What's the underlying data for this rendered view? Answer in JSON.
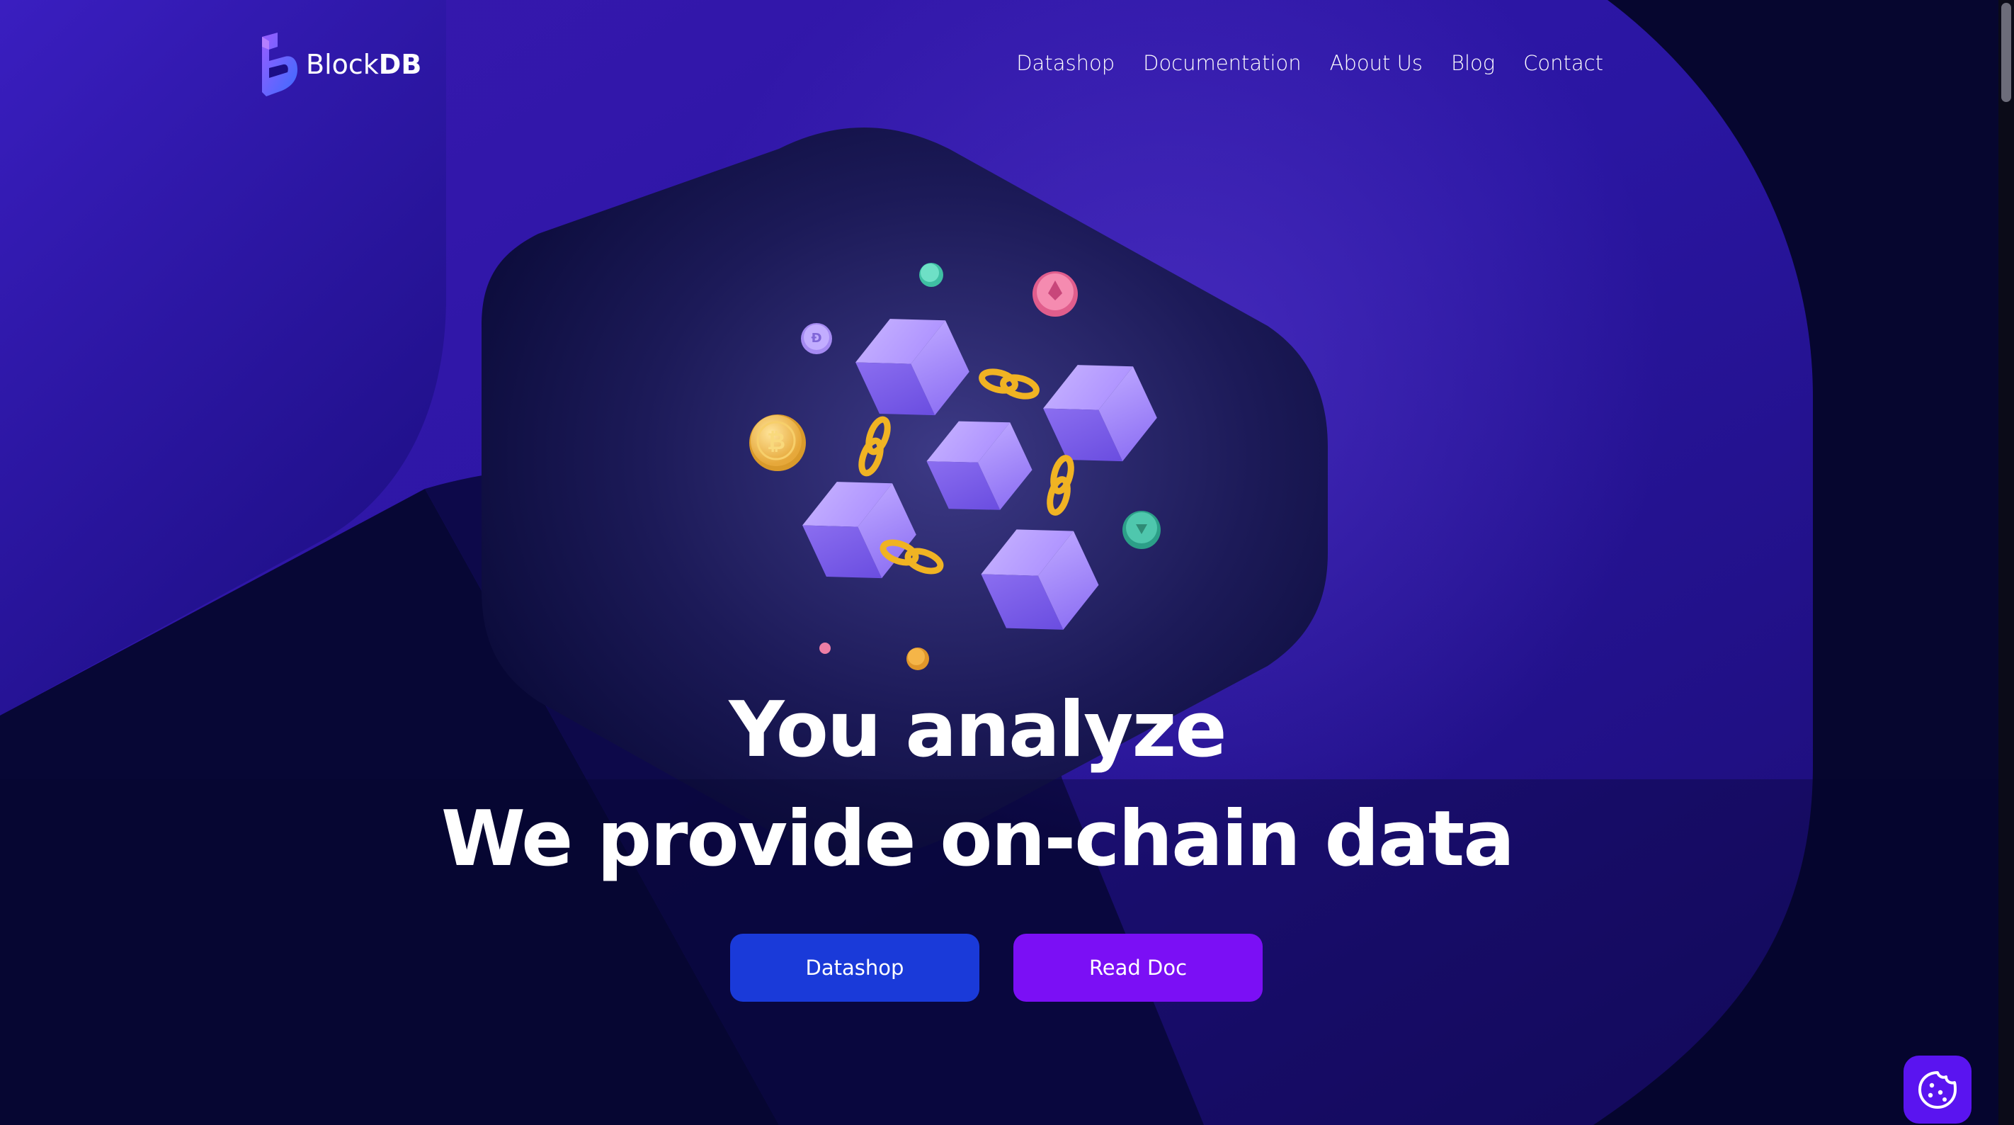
{
  "brand": {
    "name_light": "Block",
    "name_bold": "DB",
    "logo_icon": "blockdb-logo-icon"
  },
  "nav": {
    "items": [
      {
        "label": "Datashop"
      },
      {
        "label": "Documentation"
      },
      {
        "label": "About Us"
      },
      {
        "label": "Blog"
      },
      {
        "label": "Contact"
      }
    ]
  },
  "hero": {
    "illustration_icon": "blockchain-cubes-illustration",
    "line1": "You  analyze",
    "line2": "We provide on-chain data"
  },
  "buttons": {
    "datashop_label": "Datashop",
    "readdoc_label": "Read Doc"
  },
  "cookie": {
    "icon": "cookie-icon"
  },
  "colors": {
    "background": "#05052e",
    "panel": "#2a1aa8",
    "primary_button": "#1a3ad9",
    "secondary_button": "#7b0ff5",
    "cookie_button": "#5a14f0"
  }
}
